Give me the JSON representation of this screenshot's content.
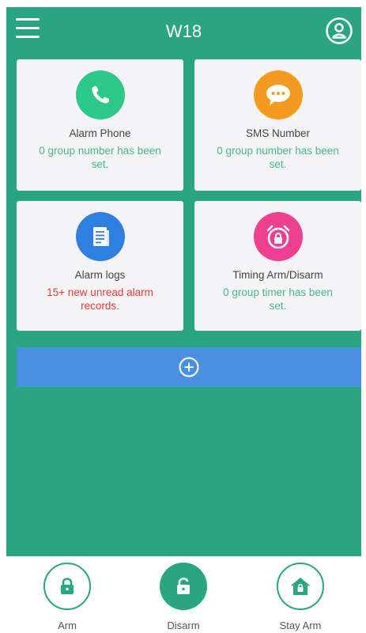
{
  "header": {
    "title": "W18",
    "menu_icon": "hamburger-menu-icon",
    "user_icon": "user-profile-icon"
  },
  "cards": {
    "alarm_phone": {
      "title": "Alarm Phone",
      "subtitle": "0 group number has been set.",
      "icon": "phone-icon",
      "color": "#2dc98a"
    },
    "sms_number": {
      "title": "SMS Number",
      "subtitle": "0 group number has been set.",
      "icon": "message-bubble-icon",
      "color": "#f39a1f"
    },
    "alarm_logs": {
      "title": "Alarm logs",
      "subtitle": "15+ new unread alarm records.",
      "icon": "document-log-icon",
      "color": "#2f7fe0"
    },
    "timing": {
      "title": "Timing Arm/Disarm",
      "subtitle": "0 group timer has been set.",
      "icon": "alarm-clock-lock-icon",
      "color": "#ee3f92"
    }
  },
  "add_bar": {
    "icon": "plus-circle-icon",
    "color": "#4a90e0"
  },
  "bottom_nav": {
    "arm": {
      "label": "Arm",
      "icon": "lock-closed-icon"
    },
    "disarm": {
      "label": "Disarm",
      "icon": "lock-open-icon"
    },
    "stay_arm": {
      "label": "Stay Arm",
      "icon": "home-lock-icon"
    }
  },
  "colors": {
    "background": "#2aa582",
    "card": "#f4f4f6",
    "status_red": "#e23b3b",
    "status_green": "#4ab58c"
  }
}
